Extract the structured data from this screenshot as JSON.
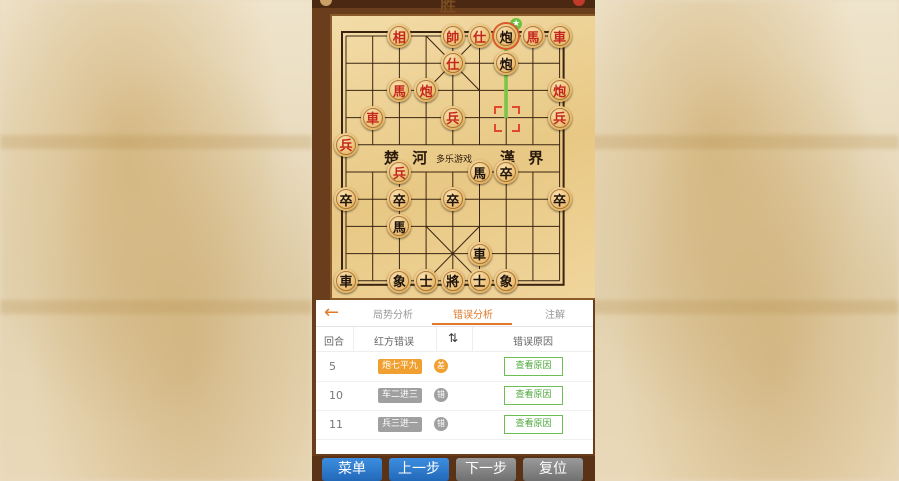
{
  "status": {
    "result_label": "胜"
  },
  "board": {
    "river_left": "楚 河",
    "river_right": "漢 界",
    "watermark": "多乐游戏",
    "pieces": [
      {
        "char": "相",
        "side": "red",
        "col": 2,
        "row": 0
      },
      {
        "char": "帥",
        "side": "red",
        "col": 4,
        "row": 0
      },
      {
        "char": "仕",
        "side": "red",
        "col": 5,
        "row": 0
      },
      {
        "char": "炮",
        "side": "black",
        "col": 6,
        "row": 0
      },
      {
        "char": "馬",
        "side": "red",
        "col": 7,
        "row": 0
      },
      {
        "char": "車",
        "side": "red",
        "col": 8,
        "row": 0
      },
      {
        "char": "仕",
        "side": "red",
        "col": 4,
        "row": 1
      },
      {
        "char": "炮",
        "side": "black",
        "col": 6,
        "row": 1
      },
      {
        "char": "馬",
        "side": "red",
        "col": 2,
        "row": 2
      },
      {
        "char": "炮",
        "side": "red",
        "col": 3,
        "row": 2
      },
      {
        "char": "炮",
        "side": "red",
        "col": 8,
        "row": 2
      },
      {
        "char": "車",
        "side": "red",
        "col": 1,
        "row": 3
      },
      {
        "char": "兵",
        "side": "red",
        "col": 4,
        "row": 3
      },
      {
        "char": "兵",
        "side": "red",
        "col": 8,
        "row": 3
      },
      {
        "char": "兵",
        "side": "red",
        "col": 0,
        "row": 4
      },
      {
        "char": "兵",
        "side": "red",
        "col": 2,
        "row": 5
      },
      {
        "char": "馬",
        "side": "black",
        "col": 5,
        "row": 5
      },
      {
        "char": "卒",
        "side": "black",
        "col": 6,
        "row": 5
      },
      {
        "char": "卒",
        "side": "black",
        "col": 0,
        "row": 6
      },
      {
        "char": "卒",
        "side": "black",
        "col": 2,
        "row": 6
      },
      {
        "char": "卒",
        "side": "black",
        "col": 4,
        "row": 6
      },
      {
        "char": "卒",
        "side": "black",
        "col": 8,
        "row": 6
      },
      {
        "char": "馬",
        "side": "black",
        "col": 2,
        "row": 7
      },
      {
        "char": "車",
        "side": "black",
        "col": 5,
        "row": 8
      },
      {
        "char": "車",
        "side": "black",
        "col": 0,
        "row": 9
      },
      {
        "char": "象",
        "side": "black",
        "col": 2,
        "row": 9
      },
      {
        "char": "士",
        "side": "black",
        "col": 3,
        "row": 9
      },
      {
        "char": "將",
        "side": "black",
        "col": 4,
        "row": 9
      },
      {
        "char": "士",
        "side": "black",
        "col": 5,
        "row": 9
      },
      {
        "char": "象",
        "side": "black",
        "col": 6,
        "row": 9
      }
    ],
    "last_move": {
      "from_col": 6,
      "from_row": 0,
      "to_col": 6,
      "to_row": 3
    }
  },
  "panel": {
    "back_label": "←",
    "tabs": [
      {
        "label": "局势分析",
        "active": false
      },
      {
        "label": "错误分析",
        "active": true
      },
      {
        "label": "注解",
        "active": false
      }
    ],
    "headers": {
      "round": "回合",
      "red_error": "红方错误",
      "sort_icon": "⇅",
      "reason": "错误原因"
    },
    "rows": [
      {
        "round": "5",
        "move": "炮七平九",
        "move_color": "#f0a030",
        "grade": "差",
        "grade_color": "#f0a030",
        "button": "查看原因"
      },
      {
        "round": "10",
        "move": "车二进三",
        "move_color": "#a0a0a0",
        "grade": "错",
        "grade_color": "#a0a0a0",
        "button": "查看原因"
      },
      {
        "round": "11",
        "move": "兵三进一",
        "move_color": "#a0a0a0",
        "grade": "错",
        "grade_color": "#a0a0a0",
        "button": "查看原因"
      }
    ]
  },
  "nav": {
    "menu": "菜单",
    "prev": "上一步",
    "next": "下一步",
    "reset": "复位"
  }
}
